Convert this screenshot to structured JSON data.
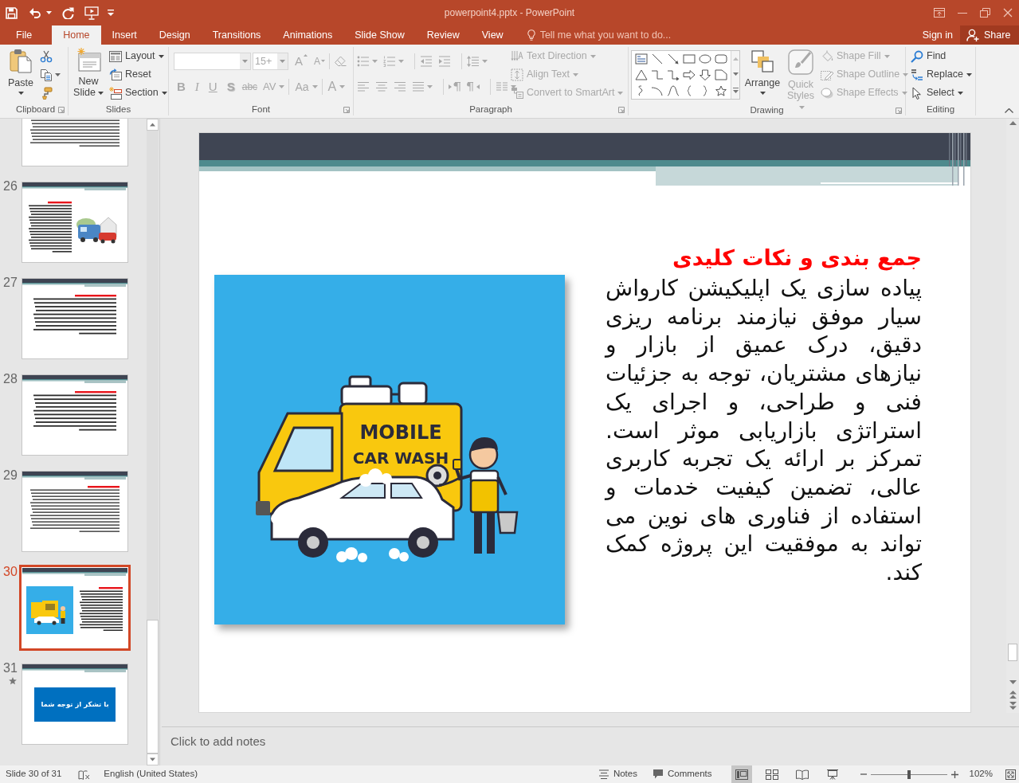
{
  "window": {
    "title": "powerpoint4.pptx - PowerPoint"
  },
  "tabs": [
    {
      "label": "File",
      "selected": false
    },
    {
      "label": "Home",
      "selected": true
    },
    {
      "label": "Insert",
      "selected": false
    },
    {
      "label": "Design",
      "selected": false
    },
    {
      "label": "Transitions",
      "selected": false
    },
    {
      "label": "Animations",
      "selected": false
    },
    {
      "label": "Slide Show",
      "selected": false
    },
    {
      "label": "Review",
      "selected": false
    },
    {
      "label": "View",
      "selected": false
    }
  ],
  "tell_me": {
    "placeholder": "Tell me what you want to do..."
  },
  "account": {
    "sign_in": "Sign in",
    "share": "Share"
  },
  "ribbon": [
    {
      "kind": "clipboard",
      "label": "Clipboard",
      "launcher": true,
      "buttons": [
        {
          "label": "Paste",
          "dropdown": true,
          "disabled": false
        }
      ],
      "tools": [
        {
          "dropdown": false,
          "disabled": false
        },
        {
          "dropdown": true,
          "disabled": false
        },
        {
          "dropdown": false,
          "disabled": false
        }
      ]
    },
    {
      "kind": "slides",
      "label": "Slides",
      "launcher": false,
      "buttons": [
        {
          "label": "New Slide",
          "dropdown": true,
          "disabled": false
        },
        {
          "label": "Layout",
          "dropdown": true,
          "disabled": false
        },
        {
          "label": "Reset",
          "dropdown": false,
          "disabled": false
        },
        {
          "label": "Section",
          "dropdown": true,
          "disabled": false
        }
      ]
    },
    {
      "kind": "font",
      "label": "Font",
      "launcher": true,
      "fields": [
        {
          "disabled": true
        },
        {
          "value": "15+",
          "disabled": true
        }
      ],
      "buttons": [
        {
          "kind": "grow",
          "label": "A",
          "dropdown": false,
          "disabled": true
        },
        {
          "kind": "shrink",
          "label": "A",
          "dropdown": false,
          "disabled": true
        },
        {
          "kind": "clear",
          "dropdown": false,
          "disabled": true
        },
        {
          "kind": "bold",
          "label": "B",
          "dropdown": false,
          "disabled": true
        },
        {
          "kind": "italic",
          "label": "I",
          "dropdown": false,
          "disabled": true
        },
        {
          "kind": "underline",
          "label": "U",
          "dropdown": false,
          "disabled": true
        },
        {
          "kind": "shadow",
          "label": "S",
          "dropdown": false,
          "disabled": true
        },
        {
          "kind": "strike",
          "label": "abc",
          "dropdown": false,
          "disabled": true
        },
        {
          "kind": "spacing",
          "label": "AV",
          "dropdown": true,
          "disabled": true
        },
        {
          "kind": "case",
          "label": "Aa",
          "dropdown": true,
          "disabled": true
        },
        {
          "kind": "color",
          "label": "A",
          "dropdown": true,
          "disabled": true
        }
      ]
    },
    {
      "kind": "paragraph",
      "label": "Paragraph",
      "launcher": true,
      "tools": [
        {
          "dropdown": true,
          "disabled": true
        },
        {
          "dropdown": true,
          "disabled": true
        },
        {
          "dropdown": false,
          "disabled": true
        },
        {
          "dropdown": false,
          "disabled": true
        },
        {
          "dropdown": true,
          "disabled": true
        },
        {
          "dropdown": false,
          "disabled": true
        },
        {
          "dropdown": false,
          "disabled": true
        },
        {
          "dropdown": false,
          "disabled": true
        },
        {
          "dropdown": true,
          "disabled": true
        },
        {
          "dropdown": false,
          "disabled": true
        },
        {
          "dropdown": false,
          "disabled": true
        },
        {
          "dropdown": true,
          "disabled": true
        }
      ],
      "buttons": [
        {
          "label": "Text Direction",
          "dropdown": true,
          "disabled": true
        },
        {
          "label": "Align Text",
          "dropdown": true,
          "disabled": true
        },
        {
          "label": "Convert to SmartArt",
          "dropdown": true,
          "disabled": true
        }
      ]
    },
    {
      "kind": "drawing",
      "label": "Drawing",
      "launcher": true,
      "buttons": [
        {
          "label": "Arrange",
          "dropdown": true,
          "disabled": false
        },
        {
          "label": "Quick Styles",
          "dropdown": true,
          "disabled": true
        },
        {
          "label": "Shape Fill",
          "dropdown": true,
          "disabled": true
        },
        {
          "label": "Shape Outline",
          "dropdown": true,
          "disabled": true
        },
        {
          "label": "Shape Effects",
          "dropdown": true,
          "disabled": true
        }
      ]
    },
    {
      "kind": "editing",
      "label": "Editing",
      "launcher": false,
      "buttons": [
        {
          "label": "Find",
          "dropdown": false,
          "disabled": false
        },
        {
          "label": "Replace",
          "dropdown": true,
          "disabled": false
        },
        {
          "label": "Select",
          "dropdown": true,
          "disabled": false
        }
      ]
    }
  ],
  "slides_panel": {
    "thumbnails": [
      {
        "kind": "bullets",
        "selected": false,
        "animation": false
      },
      {
        "number": "26",
        "kind": "text_image",
        "selected": false,
        "animation": false
      },
      {
        "number": "27",
        "kind": "paragraph",
        "selected": false,
        "animation": false
      },
      {
        "number": "28",
        "kind": "paragraph",
        "selected": false,
        "animation": false
      },
      {
        "number": "29",
        "kind": "bullets",
        "selected": false,
        "animation": false
      },
      {
        "number": "30",
        "kind": "image_text",
        "selected": true,
        "animation": false
      },
      {
        "number": "31",
        "kind": "thanks",
        "text": "با تشکر از توجه شما",
        "selected": false,
        "animation": true
      }
    ]
  },
  "slide": {
    "title": "جمع بندی و نکات کلیدی",
    "body": "پیاده سازی یک اپلیکیشن کارواش سیار موفق نیازمند برنامه ریزی دقیق، درک عمیق از بازار و نیازهای مشتریان، توجه به جزئیات فنی و طراحی، و اجرای یک استراتژی بازاریابی موثر است. تمرکز بر ارائه یک تجربه کاربری عالی، تضمین کیفیت خدمات و استفاده از فناوری های نوین می تواند به موفقیت این پروژه کمک کند.",
    "illustration": {
      "sign": [
        "MOBILE",
        "CAR WASH"
      ]
    }
  },
  "notes": {
    "placeholder": "Click to add notes"
  },
  "status_bar": {
    "slide_info": "Slide 30 of 31",
    "language": "English (United States)",
    "notes": "Notes",
    "comments": "Comments",
    "views": [
      {
        "selected": true
      },
      {
        "selected": false
      },
      {
        "selected": false
      },
      {
        "selected": false
      }
    ],
    "zoom": {
      "level": 0.5,
      "reading": "102%"
    }
  }
}
